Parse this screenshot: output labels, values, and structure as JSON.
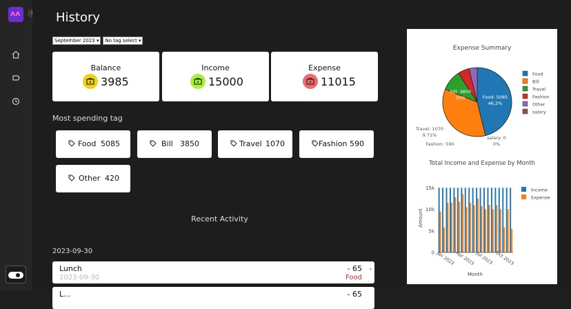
{
  "sidebar": {
    "logo_icon": "app-logo",
    "logo_text": "ʌʌ",
    "collapse_icon": "chevron-right-icon",
    "collapse_glyph": "›",
    "nav": [
      "home-icon",
      "tag-icon",
      "history-icon"
    ],
    "theme_toggle": "dark-mode-toggle"
  },
  "header": {
    "title": "History"
  },
  "filters": {
    "month": "September 2023 ▾",
    "tag": "No tag select ▾"
  },
  "summary": [
    {
      "label": "Balance",
      "value": "3985",
      "color": "#f2d30b"
    },
    {
      "label": "Income",
      "value": "15000",
      "color": "#a8f03c"
    },
    {
      "label": "Expense",
      "value": "11015",
      "color": "#ef6b6b"
    }
  ],
  "most_spending": {
    "title": "Most spending tag",
    "tags": [
      {
        "name": "Food",
        "amount": "5085"
      },
      {
        "name": "Bill",
        "amount": "3850"
      },
      {
        "name": "Travel",
        "amount": "1070"
      },
      {
        "name": "Fashion",
        "amount": "590"
      },
      {
        "name": "Other",
        "amount": "420"
      }
    ]
  },
  "recent": {
    "title": "Recent Activity",
    "date": "2023-09-30",
    "items": [
      {
        "name": "Lunch",
        "date": "2023-09-30",
        "amount": "- 65",
        "tag": "Food",
        "menu": "-"
      },
      {
        "name": "L...",
        "date": "",
        "amount": "- 65",
        "tag": "",
        "menu": ""
      }
    ]
  },
  "chart_data": [
    {
      "type": "pie",
      "title": "Expense Summary",
      "labels": [
        "Food",
        "Bill",
        "Travel",
        "Fashion",
        "Other",
        "salary"
      ],
      "values": [
        5085,
        3850,
        1070,
        590,
        420,
        0
      ],
      "colors": [
        "#1f77b4",
        "#ff7f0e",
        "#2ca02c",
        "#d62728",
        "#9467bd",
        "#8c564b"
      ],
      "slice_labels": [
        "Food: 5085\n46.2%",
        "bill: 3850\n35%",
        "Travel: 1070\n9.71%",
        "Fashion: 590",
        "",
        "salary: 0\n0%"
      ],
      "legend": "right"
    },
    {
      "type": "bar",
      "title": "Total Income and Expense by Month",
      "xlabel": "Month",
      "ylabel": "Amount",
      "tick_labels_x": [
        "Jan 2023",
        "Apr 2023",
        "Jul 2023",
        "Oct 2023"
      ],
      "tick_labels_y": [
        "0",
        "5k",
        "10k",
        "15k"
      ],
      "ylim": [
        0,
        16000
      ],
      "series": [
        {
          "name": "Income",
          "color": "#1f77b4",
          "values": [
            15000,
            15000,
            15000,
            15000,
            15000,
            15000,
            15000,
            15000,
            15000,
            15000,
            15000,
            15000,
            15000,
            15000,
            15000,
            15000,
            15000,
            15000,
            15000,
            15000
          ]
        },
        {
          "name": "Expense",
          "color": "#ff7f0e",
          "values": [
            9500,
            5800,
            11500,
            11600,
            12800,
            11800,
            13500,
            10500,
            11500,
            11000,
            12500,
            10800,
            10000,
            11000,
            10000,
            11000,
            10000,
            5800,
            10000,
            5500
          ]
        }
      ],
      "legend": "right"
    }
  ]
}
